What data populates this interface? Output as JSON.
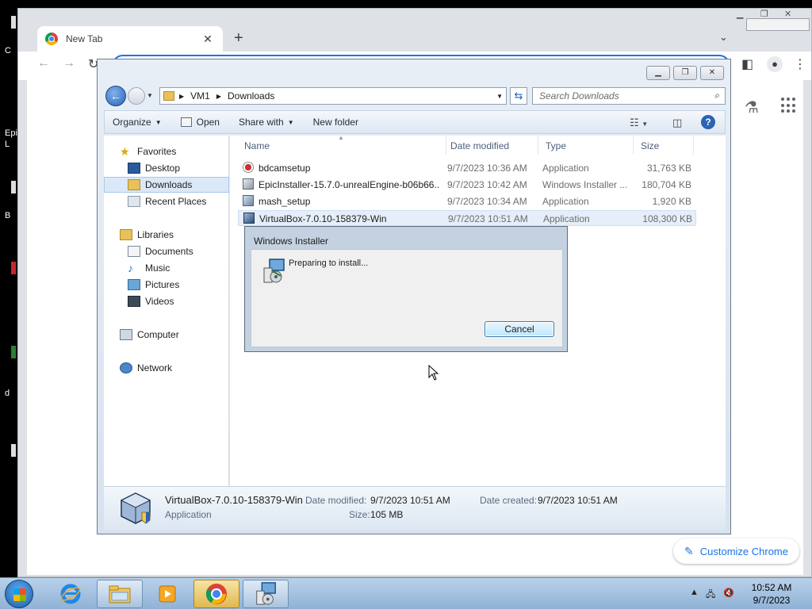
{
  "desktop": {
    "labels": [
      "C",
      "Epi",
      "L",
      "B",
      "d"
    ]
  },
  "chrome": {
    "tab_title": "New Tab",
    "tab_close": "✕",
    "new_tab": "+",
    "tab_search": "⌄",
    "customize_label": "Customize Chrome",
    "accent_color": "#1a73e8"
  },
  "explorer": {
    "breadcrumb": [
      "VM1",
      "Downloads"
    ],
    "search_placeholder": "Search Downloads",
    "commands": {
      "organize": "Organize",
      "open": "Open",
      "share_with": "Share with",
      "new_folder": "New folder"
    },
    "nav": {
      "favorites": "Favorites",
      "desktop": "Desktop",
      "downloads": "Downloads",
      "recent_places": "Recent Places",
      "libraries": "Libraries",
      "documents": "Documents",
      "music": "Music",
      "pictures": "Pictures",
      "videos": "Videos",
      "computer": "Computer",
      "network": "Network"
    },
    "columns": {
      "name": "Name",
      "date_modified": "Date modified",
      "type": "Type",
      "size": "Size"
    },
    "files": [
      {
        "name": "bdcamsetup",
        "date": "9/7/2023 10:36 AM",
        "type": "Application",
        "size": "31,763 KB",
        "icon": "bdcam-icon"
      },
      {
        "name": "EpicInstaller-15.7.0-unrealEngine-b06b66...",
        "date": "9/7/2023 10:42 AM",
        "type": "Windows Installer ...",
        "size": "180,704 KB",
        "icon": "msi-icon"
      },
      {
        "name": "mash_setup",
        "date": "9/7/2023 10:34 AM",
        "type": "Application",
        "size": "1,920 KB",
        "icon": "setup-icon"
      },
      {
        "name": "VirtualBox-7.0.10-158379-Win",
        "date": "9/7/2023 10:51 AM",
        "type": "Application",
        "size": "108,300 KB",
        "icon": "virtualbox-icon"
      }
    ],
    "details": {
      "name": "VirtualBox-7.0.10-158379-Win",
      "kind": "Application",
      "date_modified_label": "Date modified:",
      "date_modified": "9/7/2023 10:51 AM",
      "size_label": "Size:",
      "size": "105 MB",
      "date_created_label": "Date created:",
      "date_created": "9/7/2023 10:51 AM"
    }
  },
  "installer": {
    "title": "Windows Installer",
    "message": "Preparing to install...",
    "cancel": "Cancel"
  },
  "taskbar": {
    "time": "10:52 AM",
    "date": "9/7/2023",
    "apps": [
      "start-button",
      "internet-explorer-icon",
      "file-explorer-icon",
      "media-player-icon",
      "chrome-icon",
      "windows-installer-icon"
    ]
  }
}
